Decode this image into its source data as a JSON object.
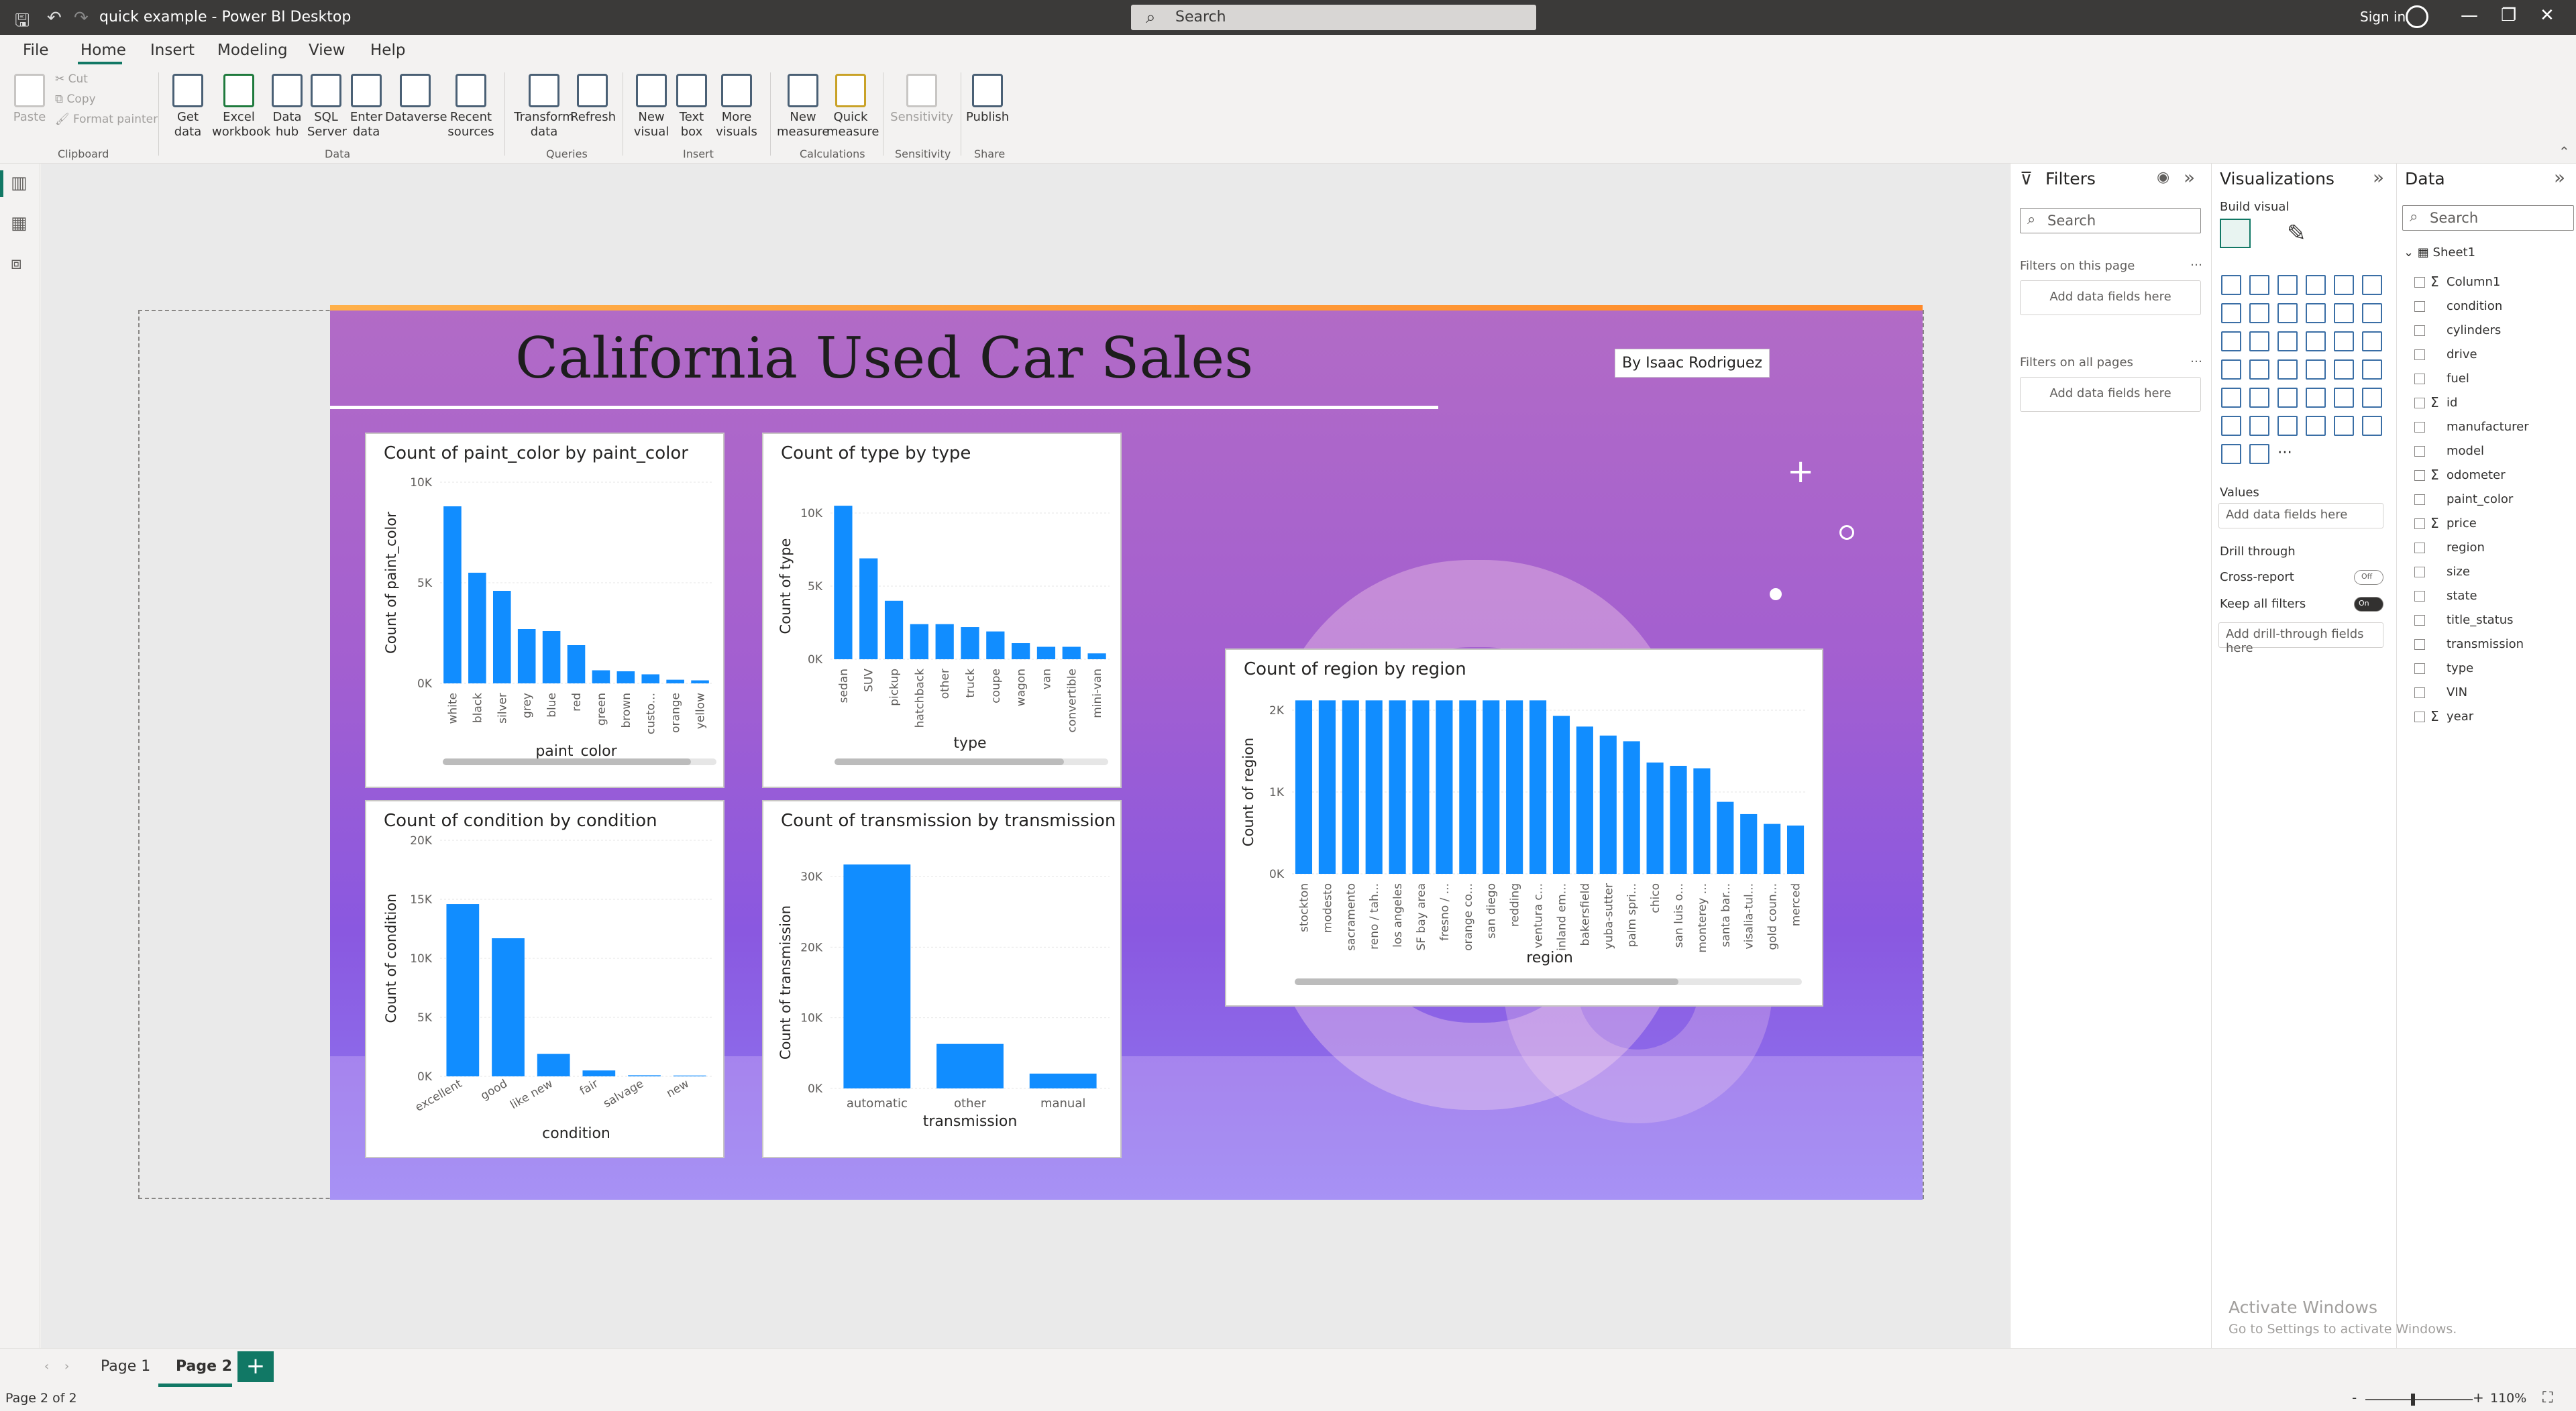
{
  "titlebar": {
    "title": "quick example - Power BI Desktop",
    "search": "Search",
    "signin": "Sign in"
  },
  "menu": {
    "file": "File",
    "home": "Home",
    "insert": "Insert",
    "modeling": "Modeling",
    "view": "View",
    "help": "Help"
  },
  "ribbon": {
    "clipboard": {
      "paste": "Paste",
      "cut": "Cut",
      "copy": "Copy",
      "format_painter": "Format painter",
      "group": "Clipboard"
    },
    "data": {
      "get_data": "Get data",
      "excel": "Excel workbook",
      "data_hub": "Data hub",
      "sql": "SQL Server",
      "enter": "Enter data",
      "dataverse": "Dataverse",
      "recent": "Recent sources",
      "group": "Data"
    },
    "queries": {
      "transform": "Transform data",
      "refresh": "Refresh",
      "group": "Queries"
    },
    "insert": {
      "new_visual": "New visual",
      "text_box": "Text box",
      "more_visuals": "More visuals",
      "group": "Insert"
    },
    "calc": {
      "new_measure": "New measure",
      "quick_measure": "Quick measure",
      "group": "Calculations"
    },
    "sens": {
      "sensitivity": "Sensitivity",
      "group": "Sensitivity"
    },
    "share": {
      "publish": "Publish",
      "group": "Share"
    }
  },
  "report": {
    "title": "California Used Car Sales",
    "byline": "By Isaac Rodriguez"
  },
  "chart_data": [
    {
      "type": "bar",
      "title": "Count of paint_color by paint_color",
      "xlabel": "paint_color",
      "ylabel": "Count of paint_color",
      "categories": [
        "white",
        "black",
        "silver",
        "grey",
        "blue",
        "red",
        "green",
        "brown",
        "custo...",
        "orange",
        "yellow"
      ],
      "values": [
        8800,
        5500,
        4600,
        2700,
        2600,
        1900,
        650,
        600,
        450,
        180,
        150
      ],
      "ylim": [
        0,
        10000
      ],
      "ticks": [
        "0K",
        "5K",
        "10K"
      ],
      "tickvals": [
        0,
        5000,
        10000
      ]
    },
    {
      "type": "bar",
      "title": "Count of type by type",
      "xlabel": "type",
      "ylabel": "Count of type",
      "categories": [
        "sedan",
        "SUV",
        "pickup",
        "hatchback",
        "other",
        "truck",
        "coupe",
        "wagon",
        "van",
        "convertible",
        "mini-van"
      ],
      "values": [
        10500,
        6900,
        4000,
        2400,
        2400,
        2200,
        1900,
        1100,
        850,
        850,
        400
      ],
      "ylim": [
        0,
        10000
      ],
      "ticks": [
        "0K",
        "5K",
        "10K"
      ],
      "tickvals": [
        0,
        5000,
        10000
      ]
    },
    {
      "type": "bar",
      "title": "Count of condition by condition",
      "xlabel": "condition",
      "ylabel": "Count of condition",
      "categories": [
        "excellent",
        "good",
        "like new",
        "fair",
        "salvage",
        "new"
      ],
      "values": [
        14600,
        11700,
        1900,
        500,
        90,
        70
      ],
      "ylim": [
        0,
        20000
      ],
      "ticks": [
        "0K",
        "5K",
        "10K",
        "15K",
        "20K"
      ],
      "tickvals": [
        0,
        5000,
        10000,
        15000,
        20000
      ]
    },
    {
      "type": "bar",
      "title": "Count of transmission by transmission",
      "xlabel": "transmission",
      "ylabel": "Count of transmission",
      "categories": [
        "automatic",
        "other",
        "manual"
      ],
      "values": [
        31700,
        6300,
        2100
      ],
      "ylim": [
        0,
        30000
      ],
      "ticks": [
        "0K",
        "10K",
        "20K",
        "30K"
      ],
      "tickvals": [
        0,
        10000,
        20000,
        30000
      ]
    },
    {
      "type": "bar",
      "title": "Count of region by region",
      "xlabel": "region",
      "ylabel": "Count of region",
      "categories": [
        "stockton",
        "modesto",
        "sacramento",
        "reno / tah...",
        "los angeles",
        "SF bay area",
        "fresno / ...",
        "orange co...",
        "san diego",
        "redding",
        "ventura c...",
        "inland em...",
        "bakersfield",
        "yuba-sutter",
        "palm spri...",
        "chico",
        "san luis o...",
        "monterey ...",
        "santa bar...",
        "visalia-tul...",
        "gold coun...",
        "merced"
      ],
      "values": [
        2550,
        2550,
        2500,
        2480,
        2460,
        2420,
        2400,
        2330,
        2290,
        2250,
        2150,
        1930,
        1800,
        1690,
        1620,
        1360,
        1320,
        1290,
        880,
        730,
        610,
        590
      ],
      "ylim": [
        0,
        2000
      ],
      "ticks": [
        "0K",
        "1K",
        "2K"
      ],
      "tickvals": [
        0,
        1000,
        2000
      ]
    }
  ],
  "filters": {
    "title": "Filters",
    "search": "Search",
    "on_page": "Filters on this page",
    "on_all": "Filters on all pages",
    "add_fields": "Add data fields here"
  },
  "viz": {
    "title": "Visualizations",
    "build": "Build visual",
    "values": "Values",
    "add_fields": "Add data fields here",
    "drill": "Drill through",
    "cross": "Cross-report",
    "keep": "Keep all filters",
    "off": "Off",
    "on": "On",
    "drill_fields": "Add drill-through fields here"
  },
  "data": {
    "title": "Data",
    "search": "Search",
    "table": "Sheet1",
    "fields": [
      {
        "n": "Column1",
        "s": "Σ"
      },
      {
        "n": "condition",
        "s": ""
      },
      {
        "n": "cylinders",
        "s": ""
      },
      {
        "n": "drive",
        "s": ""
      },
      {
        "n": "fuel",
        "s": ""
      },
      {
        "n": "id",
        "s": "Σ"
      },
      {
        "n": "manufacturer",
        "s": ""
      },
      {
        "n": "model",
        "s": ""
      },
      {
        "n": "odometer",
        "s": "Σ"
      },
      {
        "n": "paint_color",
        "s": ""
      },
      {
        "n": "price",
        "s": "Σ"
      },
      {
        "n": "region",
        "s": ""
      },
      {
        "n": "size",
        "s": ""
      },
      {
        "n": "state",
        "s": ""
      },
      {
        "n": "title_status",
        "s": ""
      },
      {
        "n": "transmission",
        "s": ""
      },
      {
        "n": "type",
        "s": ""
      },
      {
        "n": "VIN",
        "s": ""
      },
      {
        "n": "year",
        "s": "Σ"
      }
    ]
  },
  "pages": {
    "p1": "Page 1",
    "p2": "Page 2",
    "add": "+"
  },
  "status": {
    "pagecount": "Page 2 of 2",
    "zoom": "110%",
    "minus": "-",
    "plus": "+"
  },
  "activate": {
    "line1": "Activate Windows",
    "line2": "Go to Settings to activate Windows."
  }
}
